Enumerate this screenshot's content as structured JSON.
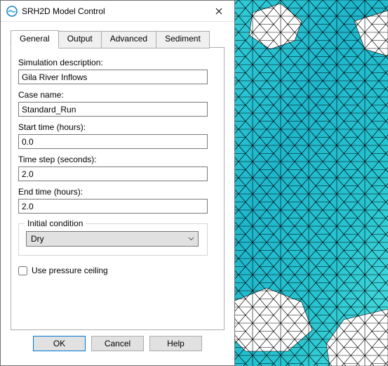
{
  "window": {
    "title": "SRH2D Model Control"
  },
  "tabs": {
    "general": "General",
    "output": "Output",
    "advanced": "Advanced",
    "sediment": "Sediment"
  },
  "general": {
    "sim_desc_label": "Simulation description:",
    "sim_desc_value": "Gila River Inflows",
    "case_name_label": "Case name:",
    "case_name_value": "Standard_Run",
    "start_time_label": "Start time (hours):",
    "start_time_value": "0.0",
    "time_step_label": "Time step (seconds):",
    "time_step_value": "2.0",
    "end_time_label": "End time (hours):",
    "end_time_value": "2.0",
    "initial_condition_legend": "Initial condition",
    "initial_condition_value": "Dry",
    "pressure_ceiling_label": "Use pressure ceiling"
  },
  "buttons": {
    "ok": "OK",
    "cancel": "Cancel",
    "help": "Help"
  }
}
